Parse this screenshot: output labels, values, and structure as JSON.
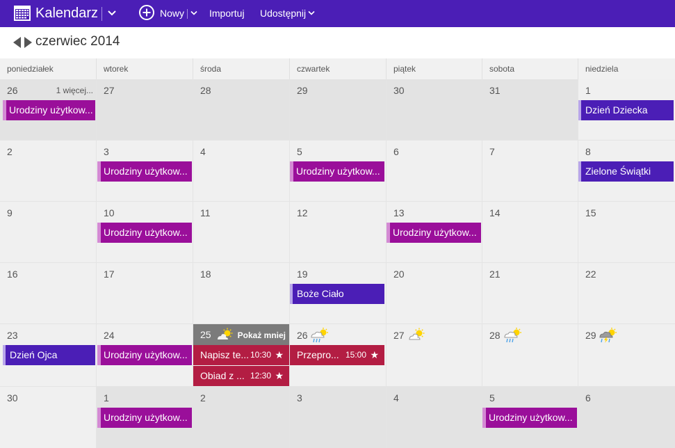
{
  "header": {
    "app_title": "Kalendarz",
    "new_label": "Nowy",
    "import_label": "Importuj",
    "share_label": "Udostępnij"
  },
  "month_title": "czerwiec 2014",
  "weekdays": [
    "poniedziałek",
    "wtorek",
    "środa",
    "czwartek",
    "piątek",
    "sobota",
    "niedziela"
  ],
  "weeks": [
    [
      "26",
      "27",
      "28",
      "29",
      "30",
      "31",
      "1"
    ],
    [
      "2",
      "3",
      "4",
      "5",
      "6",
      "7",
      "8"
    ],
    [
      "9",
      "10",
      "11",
      "12",
      "13",
      "14",
      "15"
    ],
    [
      "16",
      "17",
      "18",
      "19",
      "20",
      "21",
      "22"
    ],
    [
      "23",
      "24",
      "25",
      "26",
      "27",
      "28",
      "29"
    ],
    [
      "30",
      "1",
      "2",
      "3",
      "4",
      "5",
      "6"
    ]
  ],
  "more_link": "1 więcej...",
  "events": {
    "birthday": "Urodziny użytkow...",
    "childrens_day": "Dzień Dziecka",
    "pentecost": "Zielone Świątki",
    "corpus_christi": "Boże Ciało",
    "fathers_day": "Dzień Ojca"
  },
  "today": {
    "day": "25",
    "toggle_label": "Pokaż mniej"
  },
  "tasks": [
    {
      "title": "Napisz te...",
      "time": "10:30",
      "star": "★"
    },
    {
      "title": "Obiad z ...",
      "time": "12:30",
      "star": "★"
    },
    {
      "title": "Przepro...",
      "time": "15:00",
      "star": "★"
    }
  ],
  "weather": [
    "partly-sunny-icon",
    "rain-sun-icon",
    "partly-sunny-icon",
    "rain-sun-icon",
    "storm-sun-icon"
  ],
  "colors": {
    "accent": "#4b1eb6",
    "birthday": "#9a0f9a",
    "task": "#b31d43",
    "today_header": "#7b7b7b"
  }
}
